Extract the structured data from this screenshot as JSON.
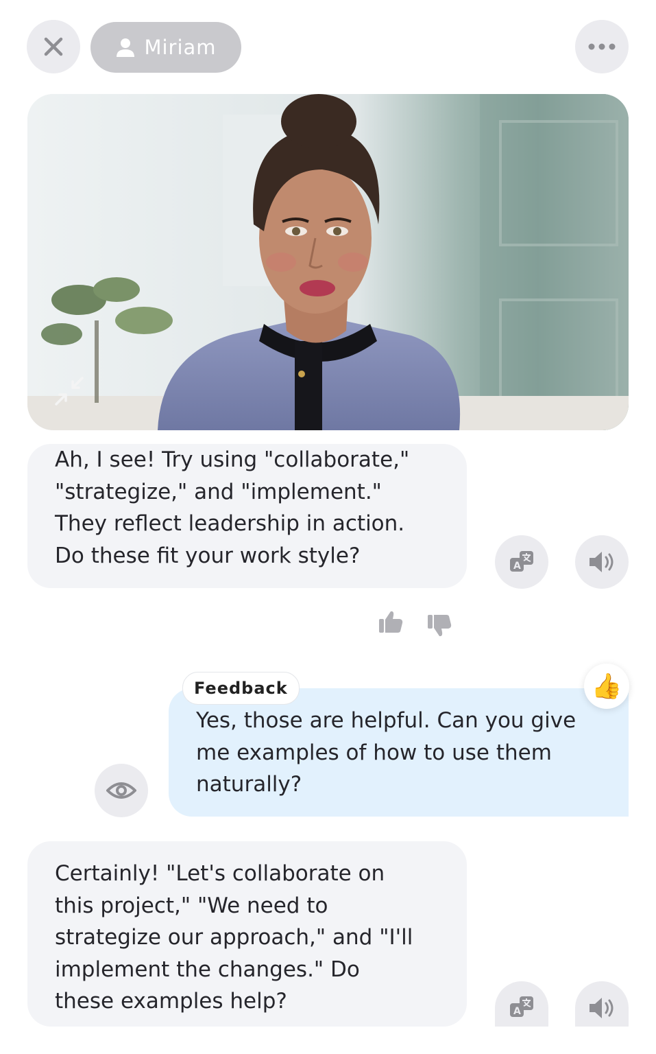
{
  "header": {
    "contact_name": "Miriam",
    "close_icon": "close-icon",
    "more_icon": "more-horizontal-icon"
  },
  "video": {
    "collapse_icon": "collapse-arrows-icon"
  },
  "messages": [
    {
      "role": "assistant",
      "lines": [
        "Ah, I see! Try using \"collaborate,\"",
        "\"strategize,\" and \"implement.\"",
        "They reflect leadership in action.",
        "Do these fit your work style?"
      ]
    },
    {
      "role": "user",
      "tag": "Feedback",
      "reaction": "👍",
      "lines": [
        "Yes, those are helpful. Can you give",
        "me examples of how to use them",
        "naturally?"
      ]
    },
    {
      "role": "assistant",
      "lines": [
        "Certainly! \"Let's collaborate on",
        "this project,\" \"We need to",
        "strategize our approach,\" and \"I'll",
        "implement the changes.\" Do",
        "these examples help?"
      ]
    }
  ],
  "icons": {
    "translate": "translate-icon",
    "speaker": "speaker-icon",
    "thumbs_up": "thumbs-up-icon",
    "thumbs_down": "thumbs-down-icon",
    "eye": "eye-icon"
  },
  "colors": {
    "bot_bubble": "#f3f4f7",
    "user_bubble": "#e2f1fd",
    "button_bg": "#ebebef",
    "pill_bg": "#c9c9cd",
    "icon_gray": "#8e8e93"
  }
}
